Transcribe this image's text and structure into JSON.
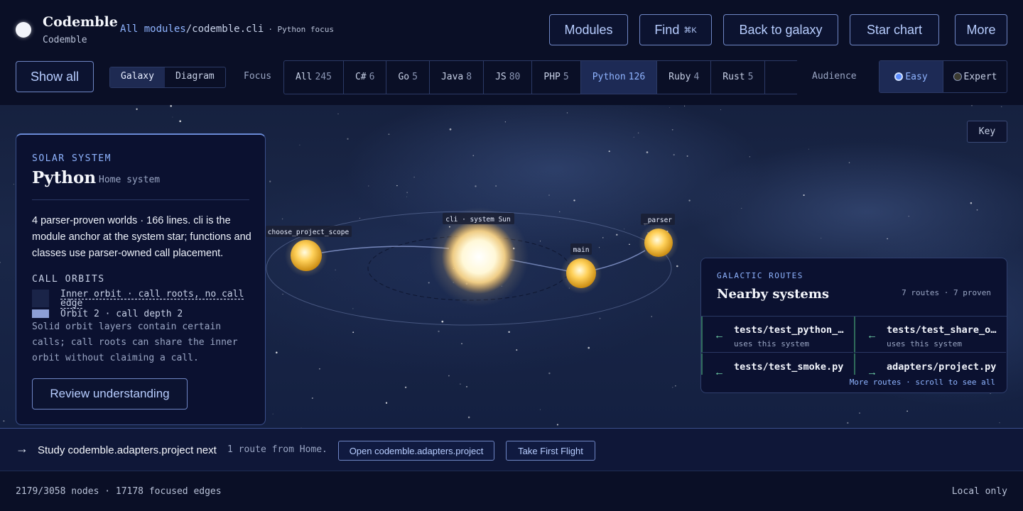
{
  "header": {
    "brand": "Codemble",
    "brand_sub": "Codemble",
    "breadcrumb": {
      "root": "All modules",
      "sep": "/",
      "current": "codemble.cli",
      "focus": "· Python focus"
    },
    "nav": [
      {
        "label": "Modules"
      },
      {
        "label": "Find",
        "shortcut": "⌘K"
      },
      {
        "label": "Back to galaxy"
      },
      {
        "label": "Star chart"
      },
      {
        "label": "More"
      }
    ]
  },
  "toolbar": {
    "show_all": "Show all",
    "views": [
      "Galaxy",
      "Diagram"
    ],
    "active_view": "Galaxy",
    "focus_label": "Focus",
    "focus_tabs": [
      {
        "label": "All",
        "count": "245"
      },
      {
        "label": "C#",
        "count": "6"
      },
      {
        "label": "Go",
        "count": "5"
      },
      {
        "label": "Java",
        "count": "8"
      },
      {
        "label": "JS",
        "count": "80"
      },
      {
        "label": "PHP",
        "count": "5"
      },
      {
        "label": "Python",
        "count": "126",
        "active": true
      },
      {
        "label": "Ruby",
        "count": "4"
      },
      {
        "label": "Rust",
        "count": "5"
      }
    ],
    "audience_label": "Audience",
    "audience": [
      {
        "label": "Easy",
        "active": true
      },
      {
        "label": "Expert",
        "active": false
      }
    ]
  },
  "canvas": {
    "key_button": "Key",
    "planets": {
      "sun": "cli · system Sun",
      "p1": "choose_project_scope",
      "p2": "main",
      "p3": "_parser"
    }
  },
  "system_panel": {
    "kicker": "SOLAR SYSTEM",
    "title": "Python",
    "tag": "Home system",
    "description": "4 parser-proven worlds · 166 lines. cli is the module anchor at the system star; functions and classes use parser-owned call placement.",
    "orbits_heading": "CALL ORBITS",
    "legend": [
      {
        "label": "Inner orbit · call roots, no call edge",
        "color": "#1a2448"
      },
      {
        "label": "Orbit 2 · call depth 2",
        "color": "#8d9fd6"
      }
    ],
    "note": "Solid orbit layers contain certain calls; call roots can share the inner orbit without claiming a call.",
    "review_button": "Review understanding"
  },
  "routes_panel": {
    "kicker": "GALACTIC ROUTES",
    "title": "Nearby systems",
    "count": "7 routes · 7 proven",
    "routes": [
      {
        "path": "tests/test_python_adapter.py",
        "sub": "uses this system",
        "dir": "←"
      },
      {
        "path": "tests/test_share_output.py",
        "sub": "uses this system",
        "dir": "←"
      },
      {
        "path": "tests/test_smoke.py",
        "sub": "",
        "dir": "←"
      },
      {
        "path": "adapters/project.py",
        "sub": "",
        "dir": "→"
      }
    ],
    "more": "More routes · scroll to see all"
  },
  "next_bar": {
    "arrow": "→",
    "text": "Study codemble.adapters.project next",
    "sub": "1 route from Home.",
    "open_button": "Open codemble.adapters.project",
    "flight_button": "Take First Flight"
  },
  "status": {
    "left": "2179/3058 nodes · 17178 focused edges",
    "right": "Local only"
  },
  "colors": {
    "accent": "#8fb4ff",
    "panel": "#0b1130",
    "route_arrow": "#6fd3a8"
  }
}
